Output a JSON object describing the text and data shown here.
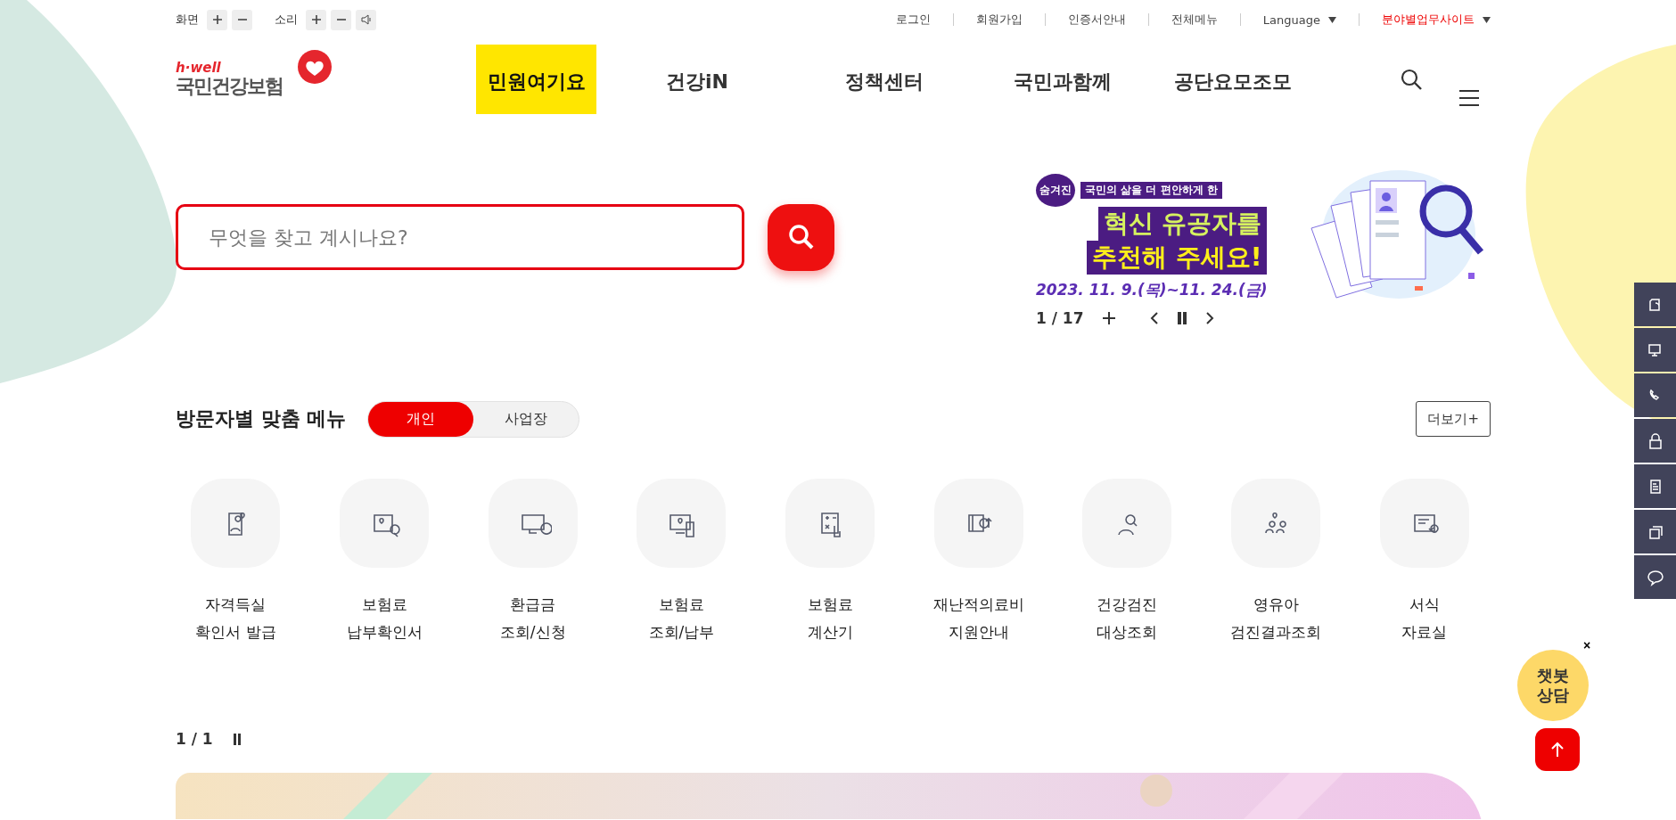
{
  "utility": {
    "screen_label": "화면",
    "sound_label": "소리",
    "links": [
      {
        "label": "로그인"
      },
      {
        "label": "회원가입"
      },
      {
        "label": "인증서안내"
      },
      {
        "label": "전체메뉴"
      }
    ],
    "language": "Language",
    "site_link": "분야별업무사이트"
  },
  "logo": {
    "tagline": "h·well",
    "name": "국민건강보험"
  },
  "nav": [
    {
      "label": "민원여기요",
      "selected": true
    },
    {
      "label": "건강iN",
      "selected": false
    },
    {
      "label": "정책센터",
      "selected": false
    },
    {
      "label": "국민과함께",
      "selected": false
    },
    {
      "label": "공단요모조모",
      "selected": false
    }
  ],
  "search": {
    "placeholder": "무엇을 찾고 계시나요?"
  },
  "banner": {
    "badge": "숨겨진",
    "subtitle": "국민의 삶을 더 편안하게 한",
    "title_1": "혁신 유공자를",
    "title_2": "추천해 주세요!",
    "dates": "2023. 11. 9.(목)~11. 24.(금)",
    "counter": "1 / 17"
  },
  "section": {
    "title": "방문자별 맞춤 메뉴",
    "tabs": [
      {
        "label": "개인",
        "selected": true
      },
      {
        "label": "사업장",
        "selected": false
      }
    ],
    "more": "더보기+"
  },
  "menu": [
    {
      "label": "자격득실\n확인서 발급"
    },
    {
      "label": "보험료\n납부확인서"
    },
    {
      "label": "환급금\n조회/신청"
    },
    {
      "label": "보험료\n조회/납부"
    },
    {
      "label": "보험료\n계산기"
    },
    {
      "label": "재난적의료비\n지원안내"
    },
    {
      "label": "건강검진\n대상조회"
    },
    {
      "label": "영유아\n검진결과조회"
    },
    {
      "label": "서식\n자료실"
    }
  ],
  "bottom": {
    "counter": "1 / 1"
  },
  "chatbot": {
    "label": "챗봇\n상담",
    "close": "×"
  }
}
